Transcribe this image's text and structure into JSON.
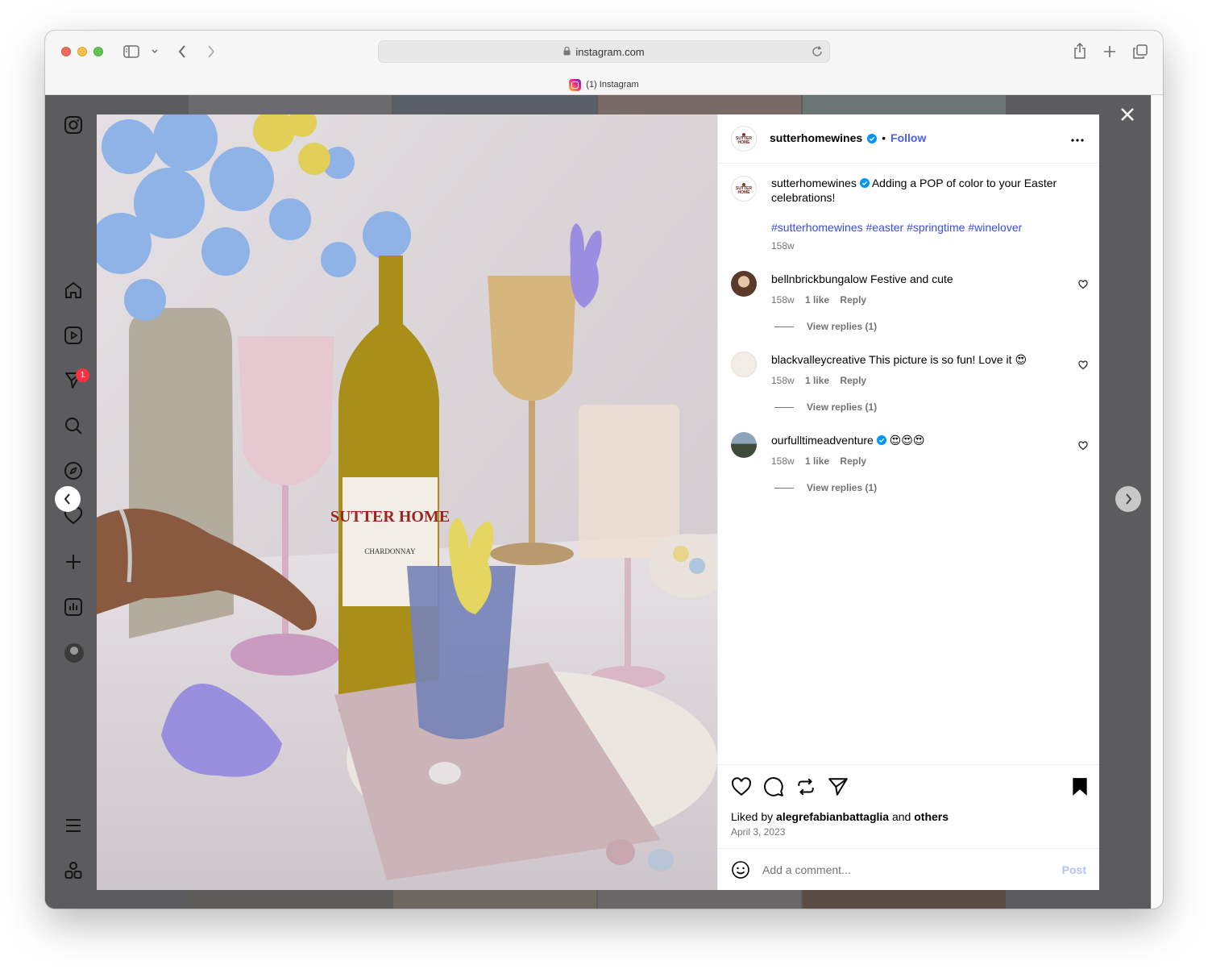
{
  "browser": {
    "url": "instagram.com",
    "tab_title": "(1) Instagram"
  },
  "sidenav": {
    "items": [
      "instagram-logo",
      "home",
      "reels",
      "messages",
      "search",
      "explore",
      "notifications",
      "create",
      "dashboard",
      "profile",
      "more",
      "also-from-meta"
    ],
    "messages_badge": "1"
  },
  "post": {
    "author": "sutterhomewines",
    "avatar_text": "SUTTER HOME",
    "follow_label": "Follow",
    "caption_text": "Adding a POP of color to your Easter celebrations!",
    "hashtags": "#sutterhomewines #easter #springtime #winelover",
    "caption_age": "158w",
    "liked_by_prefix": "Liked by",
    "liked_by_user": "alegrefabianbattaglia",
    "liked_by_and": "and",
    "liked_by_others": "others",
    "date": "April 3, 2023",
    "comment_placeholder": "Add a comment...",
    "post_label": "Post",
    "image_label": "SUTTER HOME",
    "image_sublabel": "CHARDONNAY"
  },
  "comments": [
    {
      "user": "bellnbrickbungalow",
      "text": "Festive and cute",
      "age": "158w",
      "likes": "1 like",
      "reply": "Reply",
      "view_replies": "View replies (1)"
    },
    {
      "user": "blackvalleycreative",
      "text": "This picture is so fun! Love it 😍",
      "age": "158w",
      "likes": "1 like",
      "reply": "Reply",
      "view_replies": "View replies (1)"
    },
    {
      "user": "ourfulltimeadventure",
      "text": "😍😍😍",
      "age": "158w",
      "likes": "1 like",
      "reply": "Reply",
      "view_replies": "View replies (1)"
    }
  ],
  "colors": {
    "accent": "#0095f6",
    "hashtag": "#3a4ddc",
    "muted": "#737373",
    "badge": "#ff3040"
  }
}
